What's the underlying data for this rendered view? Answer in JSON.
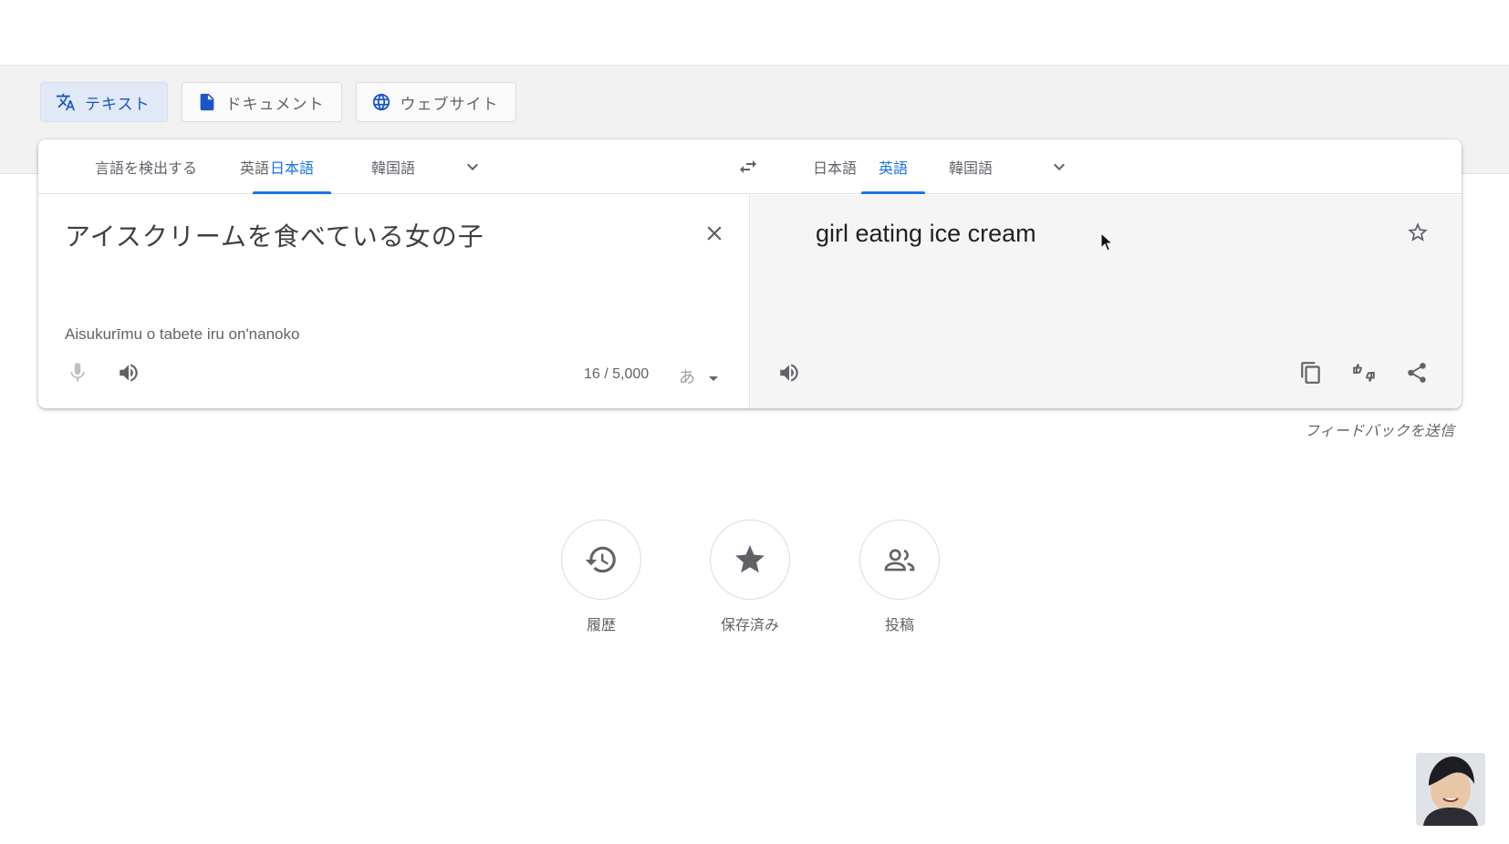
{
  "mode_tabs": [
    {
      "label": "テキスト",
      "icon": "translate-icon",
      "active": true
    },
    {
      "label": "ドキュメント",
      "icon": "document-icon",
      "active": false
    },
    {
      "label": "ウェブサイト",
      "icon": "globe-icon",
      "active": false
    }
  ],
  "source_langs": {
    "detect": "言語を検出する",
    "items": [
      "英語",
      "日本語",
      "韓国語"
    ],
    "selected": "日本語"
  },
  "target_langs": {
    "items": [
      "日本語",
      "英語",
      "韓国語"
    ],
    "selected": "英語"
  },
  "source": {
    "text": "アイスクリームを食べている女の子",
    "transliteration": "Aisukurīmu o tabete iru on'nanoko",
    "char_count": "16 / 5,000",
    "ime_label": "あ"
  },
  "target": {
    "text": "girl eating ice cream"
  },
  "feedback": "フィードバックを送信",
  "quick_actions": [
    {
      "label": "履歴",
      "icon": "history-icon"
    },
    {
      "label": "保存済み",
      "icon": "star-icon"
    },
    {
      "label": "投稿",
      "icon": "people-icon"
    }
  ],
  "colors": {
    "accent": "#1a73e8",
    "active_tab_bg": "#e1e9f7",
    "target_bg": "#f5f5f5"
  }
}
